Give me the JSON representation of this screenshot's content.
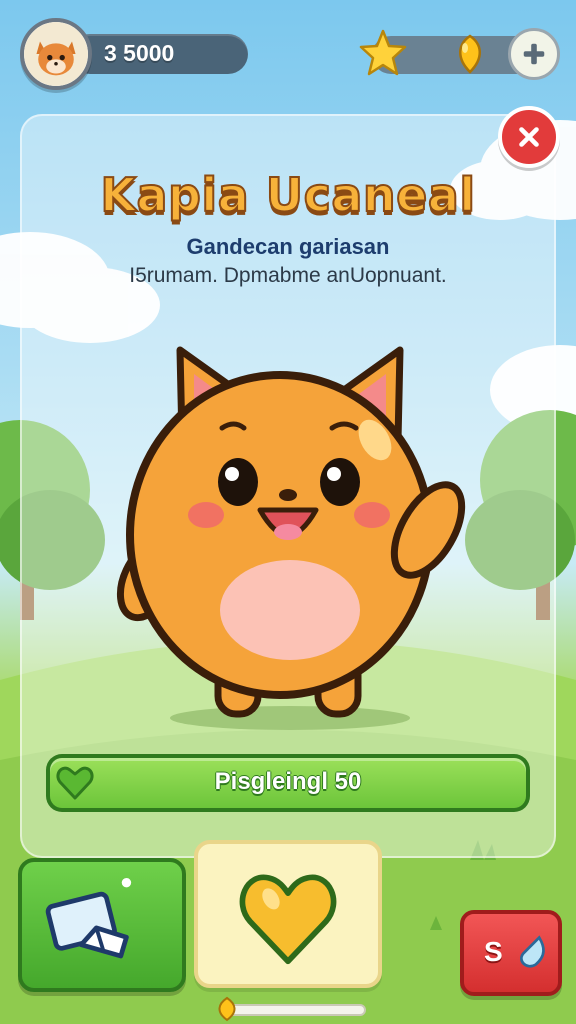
{
  "hud": {
    "coins": "3 5000",
    "avatar_icon": "fox-avatar-icon",
    "star_icon": "star-icon",
    "gem_icon": "gold-gem-icon",
    "plus_icon": "plus-icon"
  },
  "card": {
    "title": "Kapia Ucaneal",
    "subtitle": "Gandecan gariasan",
    "description": "I5rumam. Dpmabme anUopnuant.",
    "close_icon": "close-icon"
  },
  "progress": {
    "label": "Pisgleingl 50",
    "icon": "heart-icon",
    "fill_fraction": 1.0
  },
  "actions": {
    "feed_icon": "hand-pointer-icon",
    "heart_icon": "heart-icon",
    "shop_label": "S",
    "shop_icon": "droplet-icon"
  },
  "colors": {
    "title": "#f7b23a",
    "progress_green": "#6cc53a",
    "close_red": "#e23b3b",
    "pet_orange": "#f5a33a"
  }
}
